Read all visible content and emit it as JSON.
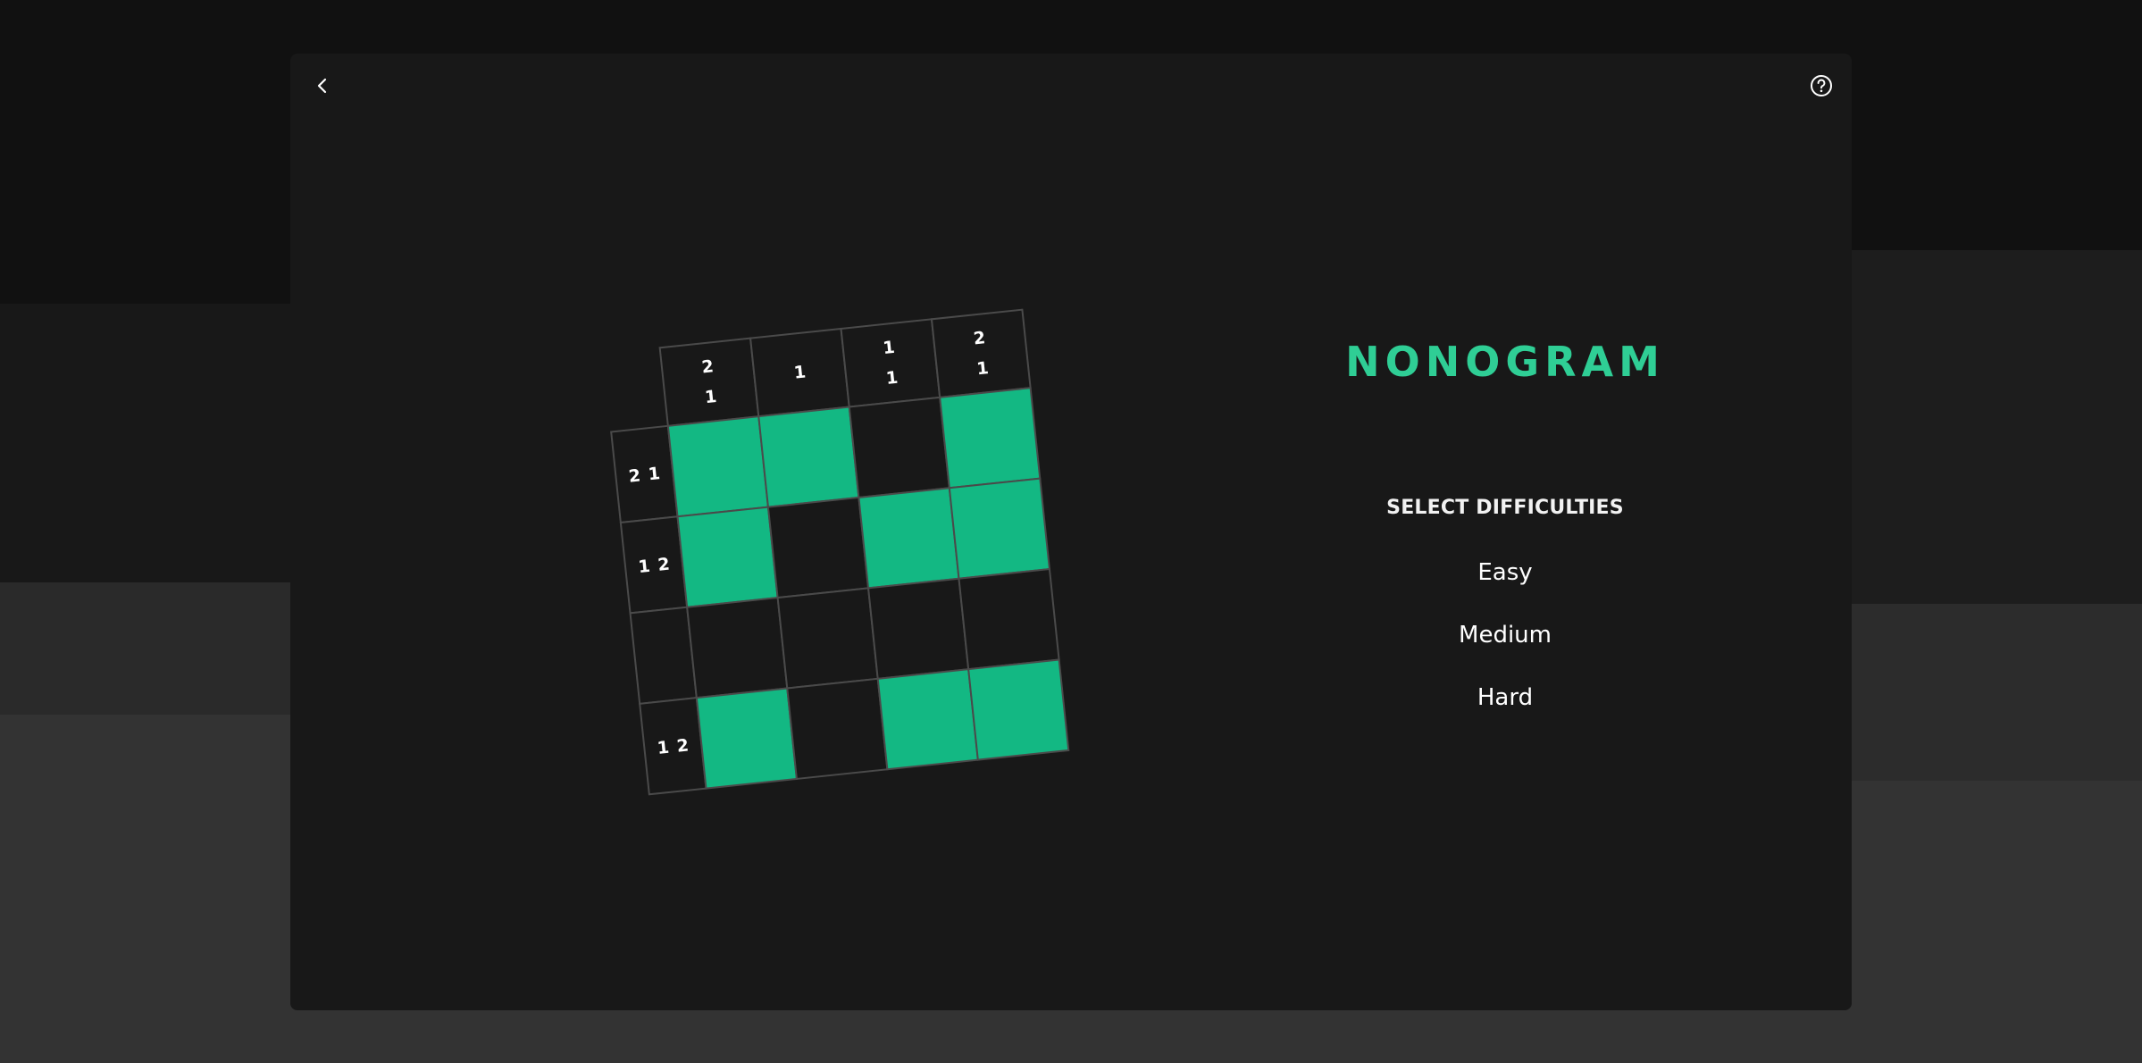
{
  "header": {
    "back_icon": "chevron-left-icon",
    "help_icon": "question-circle-icon"
  },
  "game": {
    "title": "NONOGRAM",
    "select_label": "SELECT DIFFICULTIES",
    "difficulties": [
      "Easy",
      "Medium",
      "Hard"
    ],
    "accent_color": "#13b883",
    "title_color": "#2fce95"
  },
  "preview_puzzle": {
    "column_clues": [
      [
        "2",
        "1"
      ],
      [
        "1"
      ],
      [
        "1",
        "1"
      ],
      [
        "2",
        "1"
      ]
    ],
    "row_clues": [
      [
        "2",
        "1"
      ],
      [
        "1",
        "2"
      ],
      [],
      [
        "1",
        "2"
      ]
    ],
    "cells": [
      [
        1,
        1,
        0,
        1
      ],
      [
        1,
        0,
        1,
        1
      ],
      [
        0,
        0,
        0,
        0
      ],
      [
        1,
        0,
        1,
        1
      ]
    ]
  }
}
